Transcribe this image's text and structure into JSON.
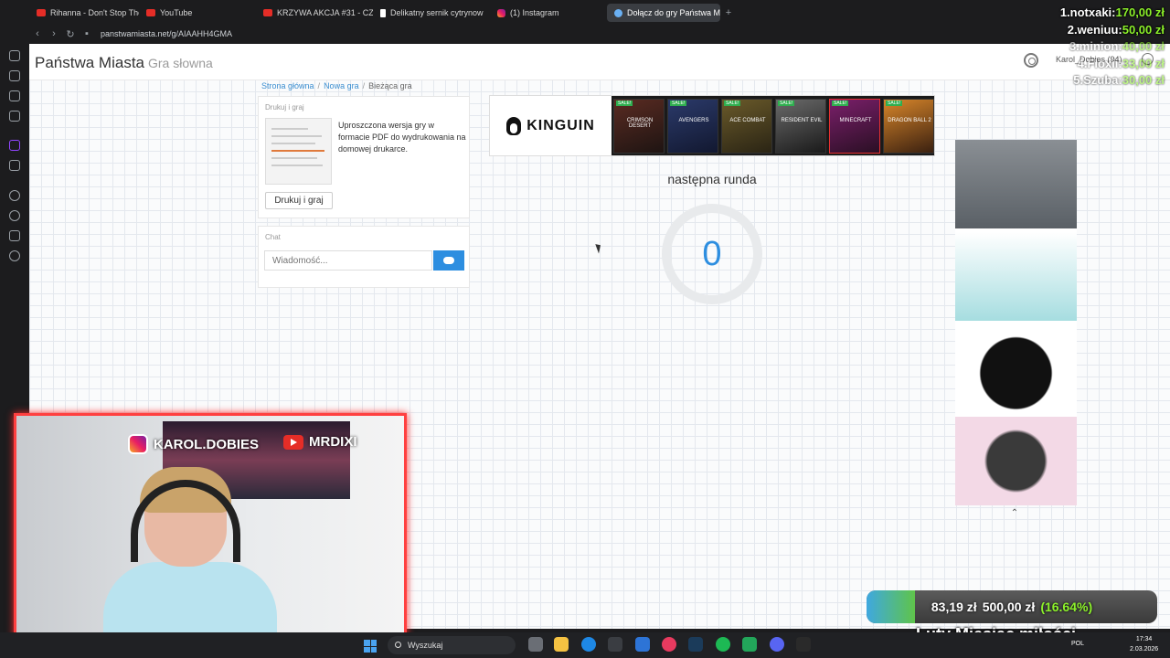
{
  "browser": {
    "tabs": [
      {
        "title": "Rihanna - Don't Stop The M",
        "icon": "youtube-icon"
      },
      {
        "title": "YouTube",
        "icon": "youtube-icon"
      },
      {
        "title": "KRZYWA AKCJA #31 - CZ",
        "icon": "youtube-icon"
      },
      {
        "title": "Delikatny sernik cytrynow",
        "icon": "tiktok-icon"
      },
      {
        "title": "(1) Instagram",
        "icon": "instagram-icon"
      },
      {
        "title": "Dołącz do gry Państwa M",
        "icon": "panstwa-miasta-icon"
      }
    ],
    "url": "panstwamiasta.net/g/AIAAHH4GMA"
  },
  "site": {
    "brand": "Państwa Miasta",
    "brand_sub": "Gra słowna",
    "user": "Karol_Dobies (94)"
  },
  "breadcrumb": [
    "Strona główna",
    "Nowa gra",
    "Bieżąca gra"
  ],
  "print_card": {
    "title": "Drukuj i graj",
    "description": "Uproszczona wersja gry w formacie PDF do wydrukowania na domowej drukarce.",
    "button": "Drukuj i graj"
  },
  "chat": {
    "title": "Chat",
    "placeholder": "Wiadomość..."
  },
  "ad_banner": {
    "brand": "KINGUIN",
    "sale_label": "SALE!",
    "games": [
      "CRIMSON DESERT",
      "AVENGERS",
      "ACE COMBAT",
      "RESIDENT EVIL",
      "MINECRAFT",
      "DRAGON BALL 2"
    ]
  },
  "game": {
    "status": "następna runda",
    "counter": "0"
  },
  "stream": {
    "donations": [
      {
        "rank": "1.notxaki:",
        "amount": "170,00 zł"
      },
      {
        "rank": "2.weniuu:",
        "amount": "50,00 zł"
      },
      {
        "rank": "3.minion:",
        "amount": "40,00 zł"
      },
      {
        "rank": "4.Floxii:",
        "amount": "33,00 zł"
      },
      {
        "rank": "5.Szuba:",
        "amount": "30,00 zł"
      }
    ],
    "socials": {
      "instagram": "KAROL.DOBIES",
      "youtube": "MRDIXI"
    },
    "goal": {
      "current": "83,19 zł",
      "target": "500,00 zł",
      "percent_label": "(16.64%)",
      "fraction": 0.1664,
      "title": "Luty Miesiąc miłości"
    }
  },
  "taskbar": {
    "search": "Wyszukaj",
    "time": "17:34",
    "date": "2.03.2026",
    "lang": "POL"
  },
  "colors": {
    "accent": "#2d8ee0",
    "overlay_red": "#ff4040",
    "donation_green": "#8cf12a"
  }
}
